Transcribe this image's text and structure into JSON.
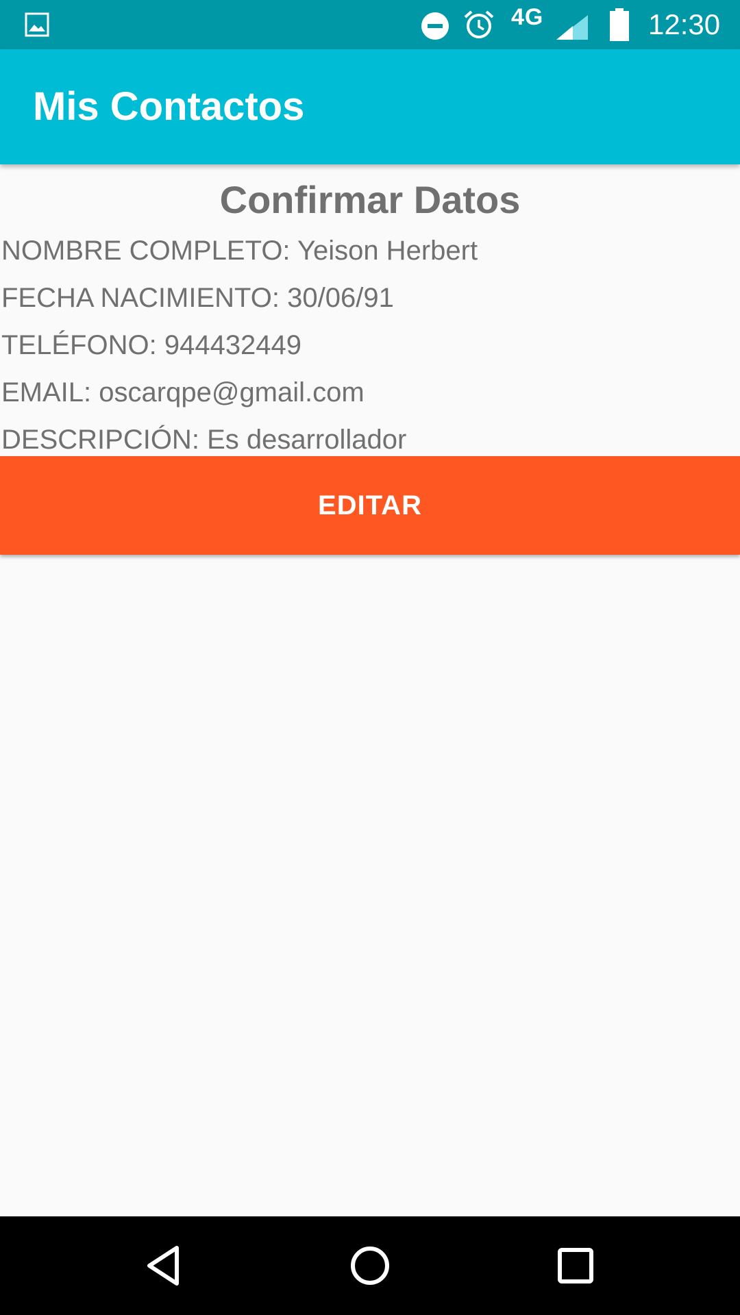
{
  "status_bar": {
    "network": "4G",
    "time": "12:30"
  },
  "app_bar": {
    "title": "Mis Contactos"
  },
  "content": {
    "heading": "Confirmar Datos",
    "fields": [
      {
        "label": "NOMBRE COMPLETO:",
        "value": "Yeison Herbert"
      },
      {
        "label": "FECHA NACIMIENTO:",
        "value": "30/06/91"
      },
      {
        "label": "TELÉFONO:",
        "value": "944432449"
      },
      {
        "label": "EMAIL:",
        "value": "oscarqpe@gmail.com"
      },
      {
        "label": "DESCRIPCIÓN:",
        "value": "Es desarrollador"
      }
    ],
    "edit_button_label": "EDITAR"
  },
  "colors": {
    "status_bar": "#0097a7",
    "app_bar": "#00bcd4",
    "accent_button": "#ff5722",
    "text_secondary": "#707070",
    "background": "#fafafa"
  },
  "icons": {
    "status_left": "gallery-icon",
    "status_right": [
      "do-not-disturb-icon",
      "alarm-icon",
      "signal-icon",
      "battery-icon"
    ],
    "nav": [
      "back-icon",
      "home-icon",
      "recents-icon"
    ]
  }
}
